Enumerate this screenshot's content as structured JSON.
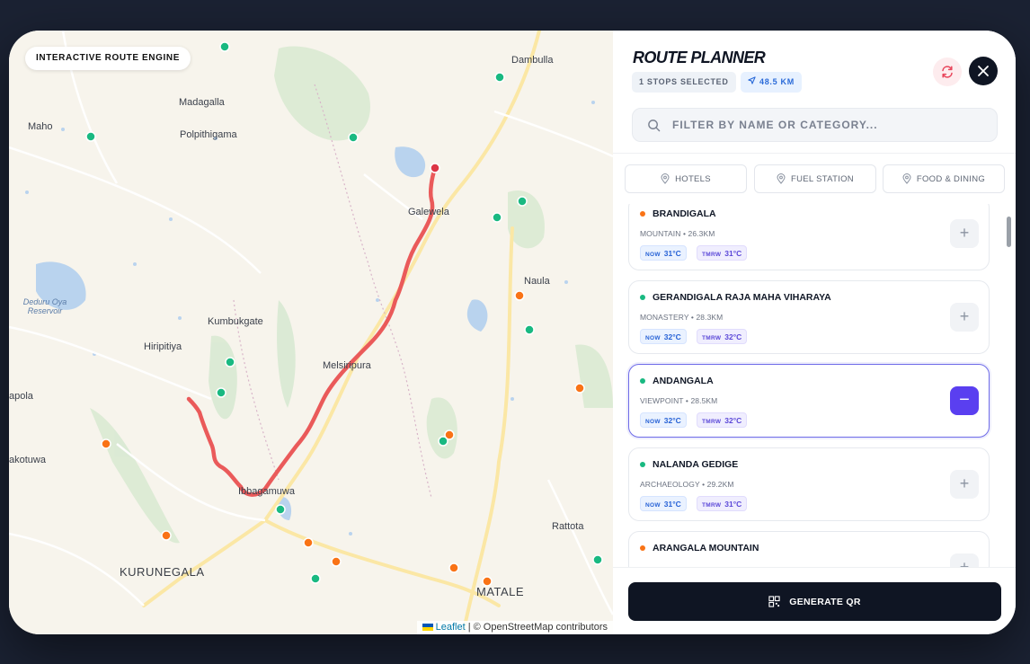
{
  "map": {
    "badge": "INTERACTIVE ROUTE ENGINE",
    "places": {
      "dambulla": "Dambulla",
      "maho": "Maho",
      "madagalla": "Madagalla",
      "polpithigama": "Polpithigama",
      "galewela": "Galewela",
      "naula": "Naula",
      "deduru": "Deduru Oya Reservoir",
      "kumbukgate": "Kumbukgate",
      "hiripitiya": "Hiripitiya",
      "melsiripura": "Melsiripura",
      "apola": "apola",
      "akotuwa": "akotuwa",
      "ibbagamuwa": "Ibbagamuwa",
      "rattota": "Rattota",
      "kurunegala": "KURUNEGALA",
      "matale": "MATALE"
    },
    "attribution": {
      "link": "Leaflet",
      "rest": "| © OpenStreetMap contributors"
    },
    "colors": {
      "route": "#ea5a5a",
      "green_marker": "#19b981",
      "orange_marker": "#f97316"
    }
  },
  "panel": {
    "title": "ROUTE PLANNER",
    "stops_chip": "1 STOPS SELECTED",
    "distance_chip": "48.5 KM",
    "search_placeholder": "FILTER BY NAME OR CATEGORY...",
    "categories": [
      "HOTELS",
      "FUEL STATION",
      "FOOD & DINING"
    ],
    "items": [
      {
        "name": "BRANDIGALA",
        "category": "MOUNTAIN",
        "distance": "26.3KM",
        "now_label": "NOW",
        "now": "31°C",
        "tmrw_label": "TMRW",
        "tmrw": "31°C",
        "dot": "#f97316",
        "selected": false
      },
      {
        "name": "GERANDIGALA RAJA MAHA VIHARAYA",
        "category": "MONASTERY",
        "distance": "28.3KM",
        "now_label": "NOW",
        "now": "32°C",
        "tmrw_label": "TMRW",
        "tmrw": "32°C",
        "dot": "#19b981",
        "selected": false
      },
      {
        "name": "ANDANGALA",
        "category": "VIEWPOINT",
        "distance": "28.5KM",
        "now_label": "NOW",
        "now": "32°C",
        "tmrw_label": "TMRW",
        "tmrw": "32°C",
        "dot": "#19b981",
        "selected": true
      },
      {
        "name": "NALANDA GEDIGE",
        "category": "ARCHAEOLOGY",
        "distance": "29.2KM",
        "now_label": "NOW",
        "now": "31°C",
        "tmrw_label": "TMRW",
        "tmrw": "31°C",
        "dot": "#19b981",
        "selected": false
      },
      {
        "name": "ARANGALA MOUNTAIN",
        "category": "",
        "distance": "",
        "now_label": "",
        "now": "",
        "tmrw_label": "",
        "tmrw": "",
        "dot": "#f97316",
        "selected": false
      }
    ],
    "meta_sep": "•",
    "generate_label": "GENERATE QR"
  }
}
